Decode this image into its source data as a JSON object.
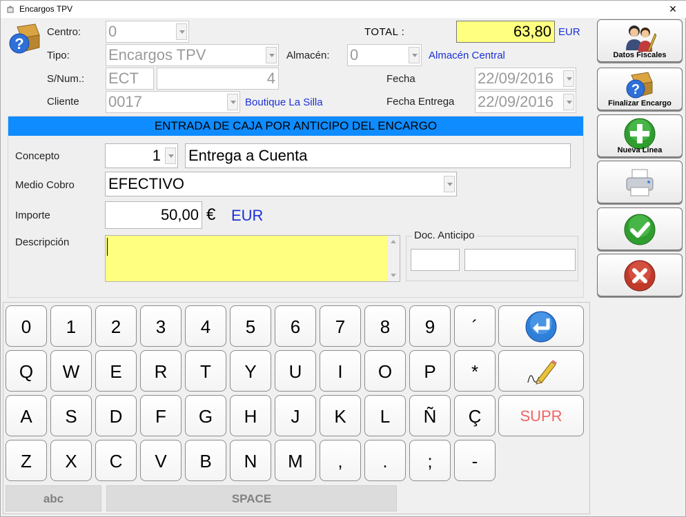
{
  "window": {
    "title": "Encargos TPV",
    "close_glyph": "×"
  },
  "header": {
    "centro": {
      "label": "Centro:",
      "value": "0"
    },
    "tipo": {
      "label": "Tipo:",
      "value": "Encargos TPV"
    },
    "almacen": {
      "label": "Almacén:",
      "value": "0",
      "name": "Almacén Central"
    },
    "snum": {
      "label": "S/Num.:",
      "serie": "ECT",
      "numero": "4"
    },
    "cliente": {
      "label": "Cliente",
      "value": "0017",
      "name": "Boutique La Silla"
    },
    "total": {
      "label": "TOTAL :",
      "value": "63,80",
      "currency": "EUR"
    },
    "fecha": {
      "label": "Fecha",
      "value": "22/09/2016"
    },
    "fecha_entrega": {
      "label": "Fecha Entrega",
      "value": "22/09/2016"
    }
  },
  "panel": {
    "title": "ENTRADA DE CAJA POR ANTICIPO DEL ENCARGO",
    "concepto": {
      "label": "Concepto",
      "code": "1",
      "text": "Entrega a Cuenta"
    },
    "medio_cobro": {
      "label": "Medio Cobro",
      "value": "EFECTIVO"
    },
    "importe": {
      "label": "Importe",
      "value": "50,00",
      "symbol": "€",
      "currency": "EUR"
    },
    "descripcion": {
      "label": "Descripción",
      "value": ""
    },
    "doc_anticipo": {
      "label": "Doc. Anticipo",
      "serie": "",
      "numero": ""
    }
  },
  "sidebar": {
    "datos_fiscales": "Datos Fiscales",
    "finalizar_encargo": "Finalizar Encargo",
    "nueva_linea": "Nueva Línea"
  },
  "keyboard": {
    "row1": [
      "0",
      "1",
      "2",
      "3",
      "4",
      "5",
      "6",
      "7",
      "8",
      "9",
      "´"
    ],
    "row2": [
      "Q",
      "W",
      "E",
      "R",
      "T",
      "Y",
      "U",
      "I",
      "O",
      "P",
      "*"
    ],
    "row3": [
      "A",
      "S",
      "D",
      "F",
      "G",
      "H",
      "J",
      "K",
      "L",
      "Ñ",
      "Ç"
    ],
    "row4": [
      "Z",
      "X",
      "C",
      "V",
      "B",
      "N",
      "M",
      ",",
      ".",
      ";",
      "-"
    ],
    "supr": "SUPR",
    "abc": "abc",
    "space": "SPACE"
  },
  "colors": {
    "total_bg": "#ffff80",
    "title_bar": "#0f8cff",
    "link": "#1b2fd6",
    "supr": "#f06464"
  }
}
